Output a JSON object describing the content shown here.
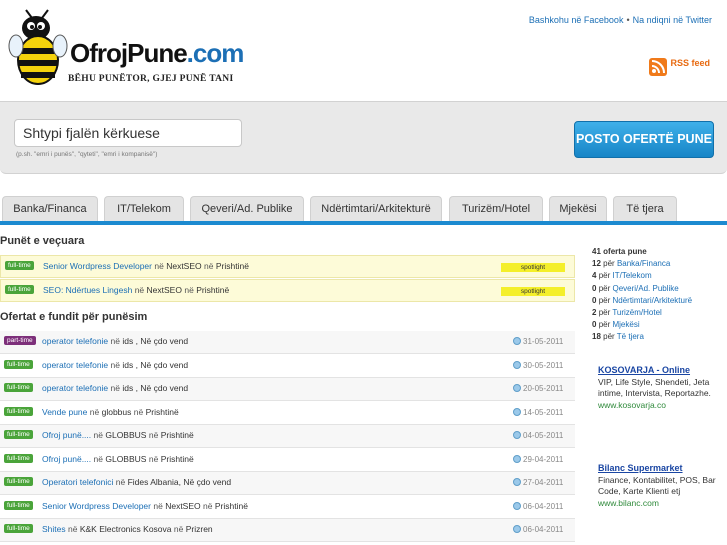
{
  "header": {
    "logo_name": "OfrojPune",
    "logo_domain": ".com",
    "tagline": "BËHU PUNËTOR, GJEJ PUNË TANI",
    "social_facebook": "Bashkohu në Facebook",
    "social_twitter": "Na ndiqni në Twitter",
    "rss_label": "RSS feed"
  },
  "search": {
    "placeholder": "Shtypi fjalën kërkuese",
    "hint": "(p.sh. \"emri i punës\", \"qyteti\", \"emri i kompanisë\")",
    "post_button": "POSTO OFERTË PUNE"
  },
  "tabs": [
    "Banka/Financa",
    "IT/Telekom",
    "Qeveri/Ad. Publike",
    "Ndërtimtari/Arkitekturë",
    "Turizëm/Hotel",
    "Mjekësi",
    "Të tjera"
  ],
  "featured": {
    "title": "Punët e veçuara",
    "rows": [
      {
        "type": "full-time",
        "title": "Senior Wordpress Developer",
        "sep1": "në",
        "company": "NextSEO",
        "sep2": "në",
        "location": "Prishtinë",
        "badge": "spotlight"
      },
      {
        "type": "full-time",
        "title": "SEO: Ndërtues Lingesh",
        "sep1": "në",
        "company": "NextSEO",
        "sep2": "në",
        "location": "Prishtinë",
        "badge": "spotlight"
      }
    ]
  },
  "latest": {
    "title": "Ofertat e fundit për punësim",
    "rows": [
      {
        "type": "part-time",
        "title": "operator telefonie",
        "sep1": "në",
        "company": "ids ,",
        "sep2": "Në çdo vend",
        "location": "",
        "date": "31-05-2011"
      },
      {
        "type": "full-time",
        "title": "operator telefonie",
        "sep1": "në",
        "company": "ids ,",
        "sep2": "Në çdo vend",
        "location": "",
        "date": "30-05-2011"
      },
      {
        "type": "full-time",
        "title": "operator telefonie",
        "sep1": "në",
        "company": "ids ,",
        "sep2": "Në çdo vend",
        "location": "",
        "date": "20-05-2011"
      },
      {
        "type": "full-time",
        "title": "Vende pune",
        "sep1": "në",
        "company": "globbus",
        "sep2": "në",
        "location": "Prishtinë",
        "date": "14-05-2011"
      },
      {
        "type": "full-time",
        "title": "Ofroj punë....",
        "sep1": "në",
        "company": "GLOBBUS",
        "sep2": "në",
        "location": "Prishtinë",
        "date": "04-05-2011"
      },
      {
        "type": "full-time",
        "title": "Ofroj punë....",
        "sep1": "në",
        "company": "GLOBBUS",
        "sep2": "në",
        "location": "Prishtinë",
        "date": "29-04-2011"
      },
      {
        "type": "full-time",
        "title": "Operatori telefonici",
        "sep1": "në",
        "company": "Fides Albania,",
        "sep2": "Në çdo vend",
        "location": "",
        "date": "27-04-2011"
      },
      {
        "type": "full-time",
        "title": "Senior Wordpress Developer",
        "sep1": "në",
        "company": "NextSEO",
        "sep2": "në",
        "location": "Prishtinë",
        "date": "06-04-2011"
      },
      {
        "type": "full-time",
        "title": "Shites",
        "sep1": "në",
        "company": "K&K Electronics Kosova",
        "sep2": "në",
        "location": "Prizren",
        "date": "06-04-2011"
      }
    ]
  },
  "sidebar": {
    "total": "41",
    "total_label": "oferta pune",
    "per": "për",
    "stats": [
      {
        "count": "12",
        "category": "Banka/Financa"
      },
      {
        "count": "4",
        "category": "IT/Telekom"
      },
      {
        "count": "0",
        "category": "Qeveri/Ad. Publike"
      },
      {
        "count": "0",
        "category": "Ndërtimtari/Arkitekturë"
      },
      {
        "count": "2",
        "category": "Turizëm/Hotel"
      },
      {
        "count": "0",
        "category": "Mjekësi"
      },
      {
        "count": "18",
        "category": "Të tjera"
      }
    ],
    "ads": [
      {
        "title": "KOSOVARJA - Online",
        "text": "VIP, Life Style, Shendeti, Jeta intime, Intervista, Reportazhe.",
        "url": "www.kosovarja.co"
      },
      {
        "title": "Bilanc Supermarket",
        "text": "Finance, Kontabilitet, POS, Bar Code, Karte Klienti etj",
        "url": "www.bilanc.com"
      }
    ]
  },
  "colors": {
    "accent": "#1c8ad0",
    "fulltime": "#4aa43a",
    "parttime": "#7d2f7a",
    "spotlight": "#f4ef2a"
  }
}
